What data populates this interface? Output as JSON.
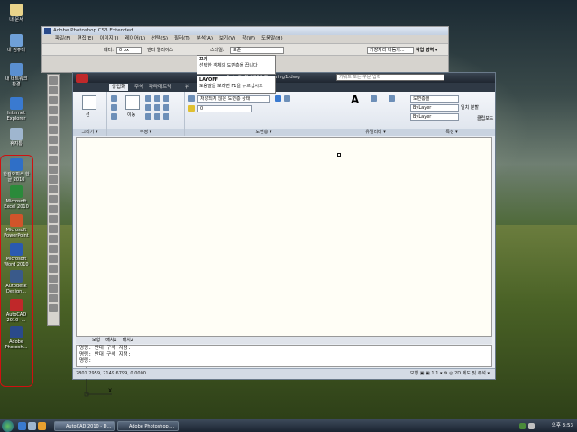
{
  "desktop": {
    "icons": [
      {
        "label": "내 문서",
        "color": "#e8d38a"
      },
      {
        "label": "내 컴퓨터",
        "color": "#6fa0d8"
      },
      {
        "label": "내 네트워크 환경",
        "color": "#5a8fd0"
      },
      {
        "label": "Internet Explorer",
        "color": "#3a7ad0"
      },
      {
        "label": "휴지통",
        "color": "#9fb6cf"
      },
      {
        "label": "한컴오피스 한글 2010",
        "color": "#2f6fc7"
      },
      {
        "label": "Microsoft Excel 2010",
        "color": "#2a8a3a"
      },
      {
        "label": "Microsoft PowerPoint",
        "color": "#d0542a"
      },
      {
        "label": "Microsoft Word 2010",
        "color": "#2a5ab0"
      },
      {
        "label": "Autodesk Design...",
        "color": "#3a5a8a"
      },
      {
        "label": "AutoCAD 2010 -...",
        "color": "#c0282a"
      },
      {
        "label": "Adobe Photosh...",
        "color": "#2a4a8a"
      }
    ]
  },
  "photoshop": {
    "title": "Adobe Photoshop CS3 Extended",
    "menu": [
      "파일(F)",
      "편집(E)",
      "이미지(I)",
      "레이어(L)",
      "선택(S)",
      "필터(T)",
      "분석(A)",
      "보기(V)",
      "창(W)",
      "도움말(H)"
    ],
    "options": {
      "feather_label": "페더:",
      "feather_value": "0 px",
      "antialias": "앤티 앨리어스",
      "style_label": "스타일:",
      "style_value": "표준",
      "workspace": "작업 영역 ▾",
      "search": "가장자리 다듬기..."
    }
  },
  "autocad": {
    "title": "AutoCAD 2010  Drawing1.dwg",
    "search_placeholder": "키워드 또는 구문 입력",
    "tabs": [
      "상업화",
      "주석",
      "파라메트릭",
      "뷰",
      "관리",
      "출력"
    ],
    "panels": [
      "그리기 ▾",
      "수정 ▾",
      "도면층 ▾",
      "유틸리티 ▾",
      "특성 ▾"
    ],
    "draw_labels": [
      "선",
      "이동"
    ],
    "layer_state": "저장되지 않은 도면층 상태",
    "layer_current": "0",
    "props": {
      "color": "도면층별",
      "linetype": "ByLayer",
      "lineweight": "ByLayer"
    },
    "right_buttons": [
      "일치 분할",
      "클립보드"
    ],
    "tooltip": {
      "title": "끄기",
      "desc": "선택한 객체의 도면층을 끕니다",
      "command": "LAYOFF",
      "help": "도움말을 보려면 F1을 누르십시오"
    },
    "layout_tabs": [
      "모형",
      "배치1",
      "배치2"
    ],
    "command_lines": [
      "명령: 반대 구석 지정:",
      "명령: 반대 구석 지정:",
      "명령:"
    ],
    "coords": "2801.2959, 2149.6799, 0.0000",
    "status_right": "모형  ▣  ▣ 1:1 ▾  ⚙  ◎ 2D 제도 및 주석 ▾"
  },
  "taskbar": {
    "buttons": [
      "AutoCAD 2010 - D...",
      "Adobe Photoshop ..."
    ],
    "clock": "오후 3:53"
  }
}
